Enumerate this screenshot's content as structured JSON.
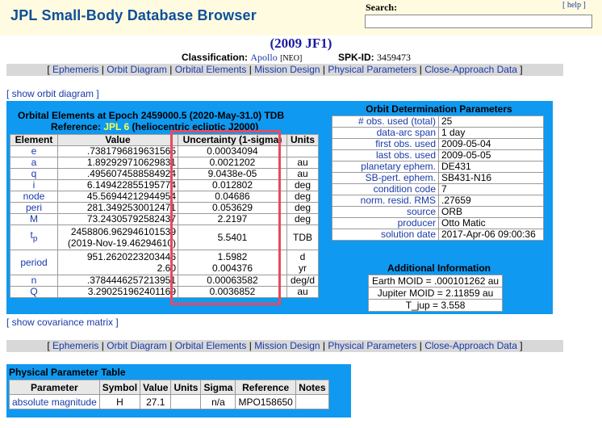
{
  "header": {
    "site_title": "JPL Small-Body Database Browser",
    "search_label": "Search:",
    "help_link": "[ help ]",
    "search_value": ""
  },
  "object": {
    "name": "(2009 JF1)",
    "classification_label": "Classification:",
    "classification_value": "Apollo",
    "classification_tag": "[NEO]",
    "spkid_label": "SPK-ID:",
    "spkid_value": "3459473"
  },
  "nav": {
    "items": [
      "Ephemeris",
      "Orbit Diagram",
      "Orbital Elements",
      "Mission Design",
      "Physical Parameters",
      "Close-Approach Data"
    ]
  },
  "links": {
    "show_orbit_diagram": "[ show orbit diagram ]",
    "show_covariance_matrix": "[ show covariance matrix ]"
  },
  "orbital_elements": {
    "title": "Orbital Elements at Epoch 2459000.5 (2020-May-31.0) TDB",
    "reference_prefix": "Reference: ",
    "reference_link": "JPL 6",
    "reference_suffix": " (heliocentric ecliptic J2000)",
    "headers": [
      "Element",
      "Value",
      "Uncertainty (1-sigma)",
      "Units"
    ],
    "rows": [
      {
        "el": "e",
        "val": ".7381796819631565",
        "unc": "0.00034094",
        "unit": ""
      },
      {
        "el": "a",
        "val": "1.892929710629831",
        "unc": "0.0021202",
        "unit": "au"
      },
      {
        "el": "q",
        "val": ".4956074588584924",
        "unc": "9.0438e-05",
        "unit": "au"
      },
      {
        "el": "i",
        "val": "6.149422855195774",
        "unc": "0.012802",
        "unit": "deg"
      },
      {
        "el": "node",
        "val": "45.56944212944954",
        "unc": "0.04686",
        "unit": "deg"
      },
      {
        "el": "peri",
        "val": "281.3492530012471",
        "unc": "0.053629",
        "unit": "deg"
      },
      {
        "el": "M",
        "val": "73.24305792582437",
        "unc": "2.2197",
        "unit": "deg"
      }
    ],
    "tp": {
      "el_main": "t",
      "el_sub": "p",
      "val1": "2458806.962946101539",
      "val2": "(2019-Nov-19.46294610)",
      "unc": "5.5401",
      "unit": "TDB"
    },
    "period": {
      "el": "period",
      "val1": "951.2620223203446",
      "val2": "2.60",
      "unc1": "1.5982",
      "unc2": "0.004376",
      "unit1": "d",
      "unit2": "yr"
    },
    "rows2": [
      {
        "el": "n",
        "val": ".3784446257213951",
        "unc": "0.00063582",
        "unit": "deg/d"
      },
      {
        "el": "Q",
        "val": "3.290251962401169",
        "unc": "0.0036852",
        "unit": "au"
      }
    ]
  },
  "orbit_determination": {
    "title": "Orbit Determination Parameters",
    "rows": [
      {
        "k": "# obs. used (total)",
        "v": "25"
      },
      {
        "k": "data-arc span",
        "v": "1 day"
      },
      {
        "k": "first obs. used",
        "v": "2009-05-04"
      },
      {
        "k": "last obs. used",
        "v": "2009-05-05"
      },
      {
        "k": "planetary ephem.",
        "v": "DE431"
      },
      {
        "k": "SB-pert. ephem.",
        "v": "SB431-N16"
      },
      {
        "k": "condition code",
        "v": "7"
      },
      {
        "k": "norm. resid. RMS",
        "v": ".27659"
      },
      {
        "k": "source",
        "v": "ORB"
      },
      {
        "k": "producer",
        "v": "Otto Matic"
      },
      {
        "k": "solution date",
        "v": "2017-Apr-06 09:00:36"
      }
    ]
  },
  "additional_info": {
    "title": "Additional Information",
    "rows": [
      "Earth MOID = .000101262 au",
      "Jupiter MOID = 2.11859 au",
      "T_jup = 3.558"
    ]
  },
  "physical_params": {
    "title": "Physical Parameter Table",
    "headers": [
      "Parameter",
      "Symbol",
      "Value",
      "Units",
      "Sigma",
      "Reference",
      "Notes"
    ],
    "row": {
      "param": "absolute magnitude",
      "symbol": "H",
      "value": "27.1",
      "units": "",
      "sigma": "n/a",
      "reference": "MPO158650",
      "notes": ""
    }
  }
}
